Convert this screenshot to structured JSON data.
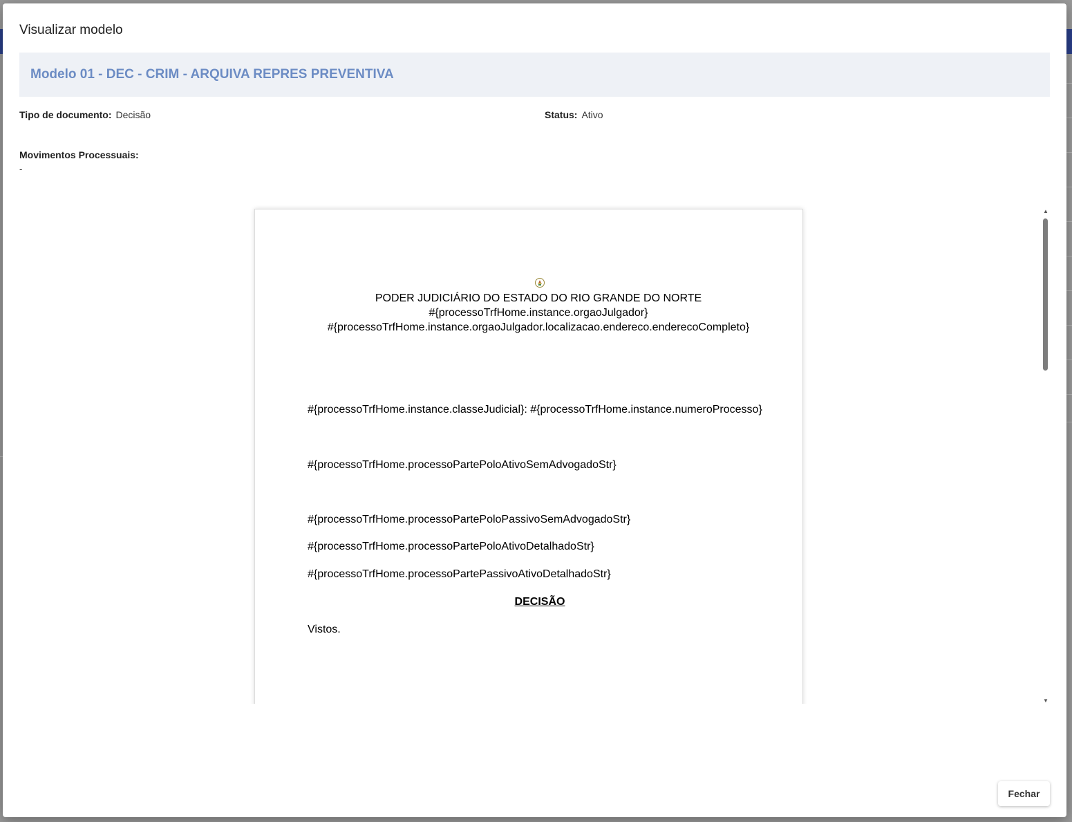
{
  "dialog": {
    "title": "Visualizar modelo",
    "model_name": "Modelo 01 - DEC - CRIM - ARQUIVA REPRES PREVENTIVA",
    "document_type_label": "Tipo de documento:",
    "document_type_value": "Decisão",
    "status_label": "Status:",
    "status_value": "Ativo",
    "movements_label": "Movimentos Processuais:",
    "movements_value": "-",
    "close_label": "Fechar"
  },
  "document": {
    "crest_icon": "court-crest-icon",
    "header_line1": "PODER JUDICIÁRIO DO ESTADO DO RIO GRANDE DO NORTE",
    "header_line2": "#{processoTrfHome.instance.orgaoJulgador}",
    "header_line3": "#{processoTrfHome.instance.orgaoJulgador.localizacao.endereco.enderecoCompleto}",
    "line_class_number": "#{processoTrfHome.instance.classeJudicial}: #{processoTrfHome.instance.numeroProcesso}",
    "line_polo_ativo": "#{processoTrfHome.processoPartePoloAtivoSemAdvogadoStr}",
    "line_polo_passivo": "#{processoTrfHome.processoPartePoloPassivoSemAdvogadoStr}",
    "line_polo_ativo_detalhado": "#{processoTrfHome.processoPartePoloAtivoDetalhadoStr}",
    "line_passivo_ativo_detalhado": "#{processoTrfHome.processoPartePassivoAtivoDetalhadoStr}",
    "decision_title": "DECISÃO",
    "body_first_line": "Vistos."
  },
  "colors": {
    "model_name": "#6c8cc4",
    "header_background": "#eef1f6",
    "background_accent": "#2a3f8a"
  }
}
